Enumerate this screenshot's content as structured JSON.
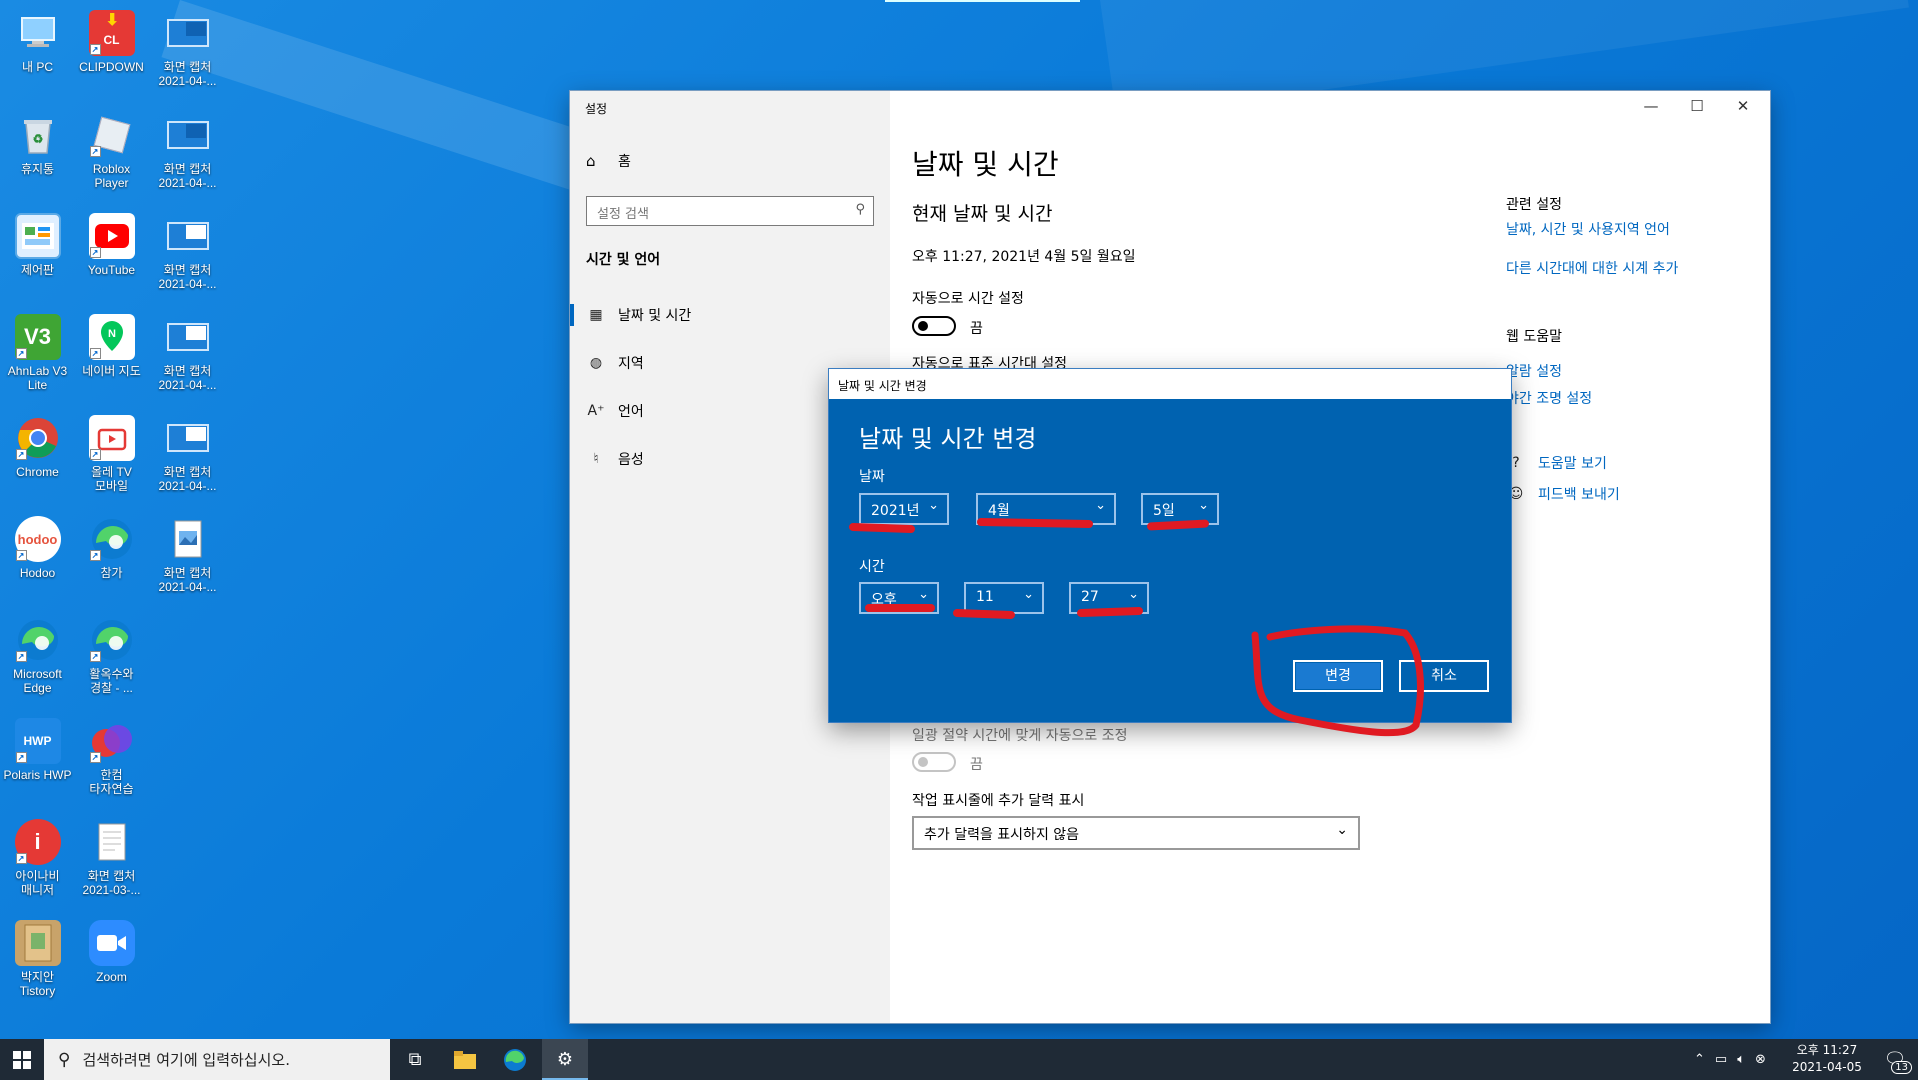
{
  "desktop": {
    "icons": [
      {
        "label": "내 PC"
      },
      {
        "label": "CLIPDOWN"
      },
      {
        "label": "화면 캡처\n2021-04-..."
      },
      {
        "label": "휴지통"
      },
      {
        "label": "Roblox\nPlayer"
      },
      {
        "label": "화면 캡처\n2021-04-..."
      },
      {
        "label": "제어판"
      },
      {
        "label": "YouTube"
      },
      {
        "label": "화면 캡처\n2021-04-..."
      },
      {
        "label": "AhnLab V3\nLite"
      },
      {
        "label": "네이버 지도"
      },
      {
        "label": "화면 캡처\n2021-04-..."
      },
      {
        "label": "Chrome"
      },
      {
        "label": "올레 TV\n모바일"
      },
      {
        "label": "화면 캡처\n2021-04-..."
      },
      {
        "label": "Hodoo"
      },
      {
        "label": "참가"
      },
      {
        "label": "화면 캡처\n2021-04-..."
      },
      {
        "label": "Microsoft\nEdge"
      },
      {
        "label": "활옥수와\n경찰 - ..."
      },
      {
        "label": "Polaris HWP"
      },
      {
        "label": "한컴\n타자연습"
      },
      {
        "label": "아이나비\n매니저"
      },
      {
        "label": "화면 캡처\n2021-03-..."
      },
      {
        "label": "박지안\nTistory"
      },
      {
        "label": "Zoom"
      }
    ]
  },
  "settings": {
    "window_title": "설정",
    "controls": {
      "minimize": "—",
      "maximize": "☐",
      "close": "✕"
    },
    "sidebar": {
      "home": "홈",
      "search_placeholder": "설정 검색",
      "section": "시간 및 언어",
      "items": [
        {
          "label": "날짜 및 시간",
          "icon": "calendar-icon"
        },
        {
          "label": "지역",
          "icon": "globe-icon"
        },
        {
          "label": "언어",
          "icon": "language-icon"
        },
        {
          "label": "음성",
          "icon": "microphone-icon"
        }
      ]
    },
    "main": {
      "title": "날짜 및 시간",
      "subtitle": "현재 날짜 및 시간",
      "current_datetime": "오후 11:27, 2021년 4월 5일 월요일",
      "auto_time_label": "자동으로 시간 설정",
      "auto_time_state": "끔",
      "auto_tz_label": "자동으로 표준 시간대 설정",
      "dst_label": "일광 절약 시간에 맞게 자동으로 조정",
      "dst_state": "끔",
      "taskbar_cal_label": "작업 표시줄에 추가 달력 표시",
      "taskbar_cal_value": "추가 달력을 표시하지 않음"
    },
    "related": {
      "heading": "관련 설정",
      "link1": "날짜, 시간 및 사용지역 언어",
      "link2": "다른 시간대에 대한 시계 추가",
      "web_help_heading": "웹 도움말",
      "link3": "알람 설정",
      "link4": "야간 조명 설정",
      "help": "도움말 보기",
      "feedback": "피드백 보내기"
    }
  },
  "dialog": {
    "title": "날짜 및 시간 변경",
    "heading": "날짜 및 시간 변경",
    "date_label": "날짜",
    "year": "2021년",
    "month": "4월",
    "day": "5일",
    "time_label": "시간",
    "ampm": "오후",
    "hour": "11",
    "minute": "27",
    "change_button": "변경",
    "cancel_button": "취소"
  },
  "taskbar": {
    "search_placeholder": "검색하려면 여기에 입력하십시오.",
    "clock_time": "오후 11:27",
    "clock_date": "2021-04-05",
    "notification_count": "13"
  },
  "colors": {
    "accent": "#0067c0",
    "dialog_bg": "#0062b0",
    "annotation_red": "#e01a22"
  }
}
